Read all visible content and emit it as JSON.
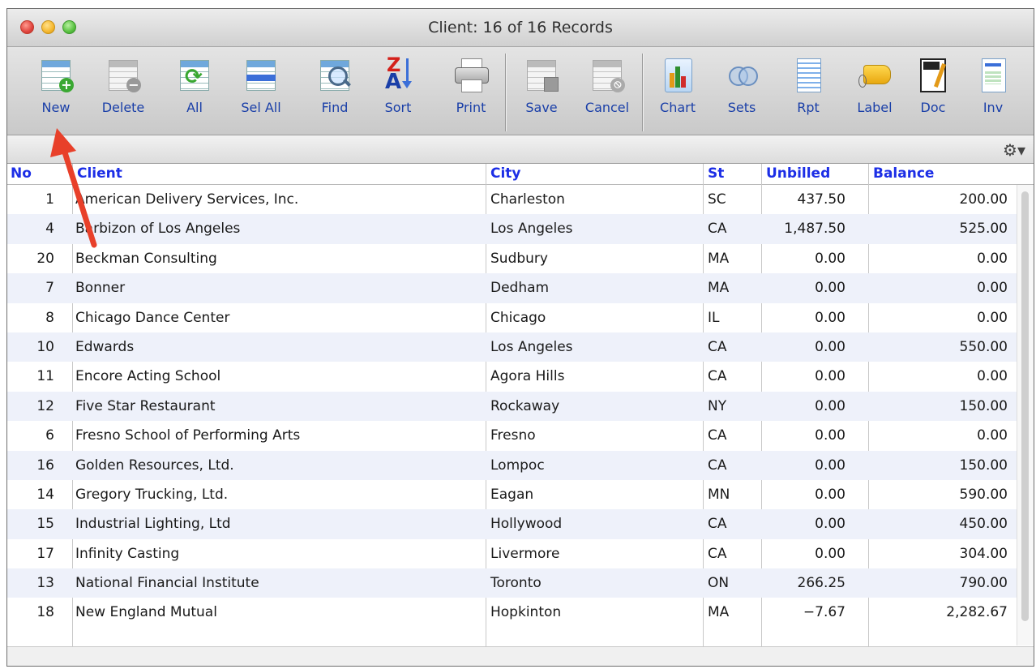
{
  "window": {
    "title": "Client: 16 of 16 Records"
  },
  "toolbar": {
    "new": "New",
    "delete": "Delete",
    "all": "All",
    "sel_all": "Sel All",
    "find": "Find",
    "sort": "Sort",
    "print": "Print",
    "save": "Save",
    "cancel": "Cancel",
    "chart": "Chart",
    "sets": "Sets",
    "rpt": "Rpt",
    "label": "Label",
    "doc": "Doc",
    "inv": "Inv",
    "sort_glyph_top": "Z",
    "sort_glyph_bottom": "A"
  },
  "filterbar": {
    "gear_glyph": "⚙▾"
  },
  "table": {
    "columns": {
      "no": "No",
      "client": "Client",
      "city": "City",
      "st": "St",
      "unbilled": "Unbilled",
      "balance": "Balance"
    },
    "rows": [
      {
        "no": "1",
        "client": "American Delivery Services, Inc.",
        "city": "Charleston",
        "st": "SC",
        "unbilled": "437.50",
        "balance": "200.00"
      },
      {
        "no": "4",
        "client": "Barbizon of Los Angeles",
        "city": "Los Angeles",
        "st": "CA",
        "unbilled": "1,487.50",
        "balance": "525.00"
      },
      {
        "no": "20",
        "client": "Beckman Consulting",
        "city": "Sudbury",
        "st": "MA",
        "unbilled": "0.00",
        "balance": "0.00"
      },
      {
        "no": "7",
        "client": "Bonner",
        "city": "Dedham",
        "st": "MA",
        "unbilled": "0.00",
        "balance": "0.00"
      },
      {
        "no": "8",
        "client": "Chicago Dance Center",
        "city": "Chicago",
        "st": "IL",
        "unbilled": "0.00",
        "balance": "0.00"
      },
      {
        "no": "10",
        "client": "Edwards",
        "city": "Los Angeles",
        "st": "CA",
        "unbilled": "0.00",
        "balance": "550.00"
      },
      {
        "no": "11",
        "client": "Encore Acting School",
        "city": "Agora Hills",
        "st": "CA",
        "unbilled": "0.00",
        "balance": "0.00"
      },
      {
        "no": "12",
        "client": "Five Star Restaurant",
        "city": "Rockaway",
        "st": "NY",
        "unbilled": "0.00",
        "balance": "150.00"
      },
      {
        "no": "6",
        "client": "Fresno School of Performing Arts",
        "city": "Fresno",
        "st": "CA",
        "unbilled": "0.00",
        "balance": "0.00"
      },
      {
        "no": "16",
        "client": "Golden Resources, Ltd.",
        "city": "Lompoc",
        "st": "CA",
        "unbilled": "0.00",
        "balance": "150.00"
      },
      {
        "no": "14",
        "client": "Gregory Trucking, Ltd.",
        "city": "Eagan",
        "st": "MN",
        "unbilled": "0.00",
        "balance": "590.00"
      },
      {
        "no": "15",
        "client": "Industrial Lighting, Ltd",
        "city": "Hollywood",
        "st": "CA",
        "unbilled": "0.00",
        "balance": "450.00"
      },
      {
        "no": "17",
        "client": "Infinity Casting",
        "city": "Livermore",
        "st": "CA",
        "unbilled": "0.00",
        "balance": "304.00"
      },
      {
        "no": "13",
        "client": "National Financial Institute",
        "city": "Toronto",
        "st": "ON",
        "unbilled": "266.25",
        "balance": "790.00"
      },
      {
        "no": "18",
        "client": "New England Mutual",
        "city": "Hopkinton",
        "st": "MA",
        "unbilled": "−7.67",
        "balance": "2,282.67"
      }
    ]
  },
  "colors": {
    "link_blue": "#1c2ee6",
    "annotation_arrow": "#e8402a",
    "alt_row": "#eef1fa"
  }
}
